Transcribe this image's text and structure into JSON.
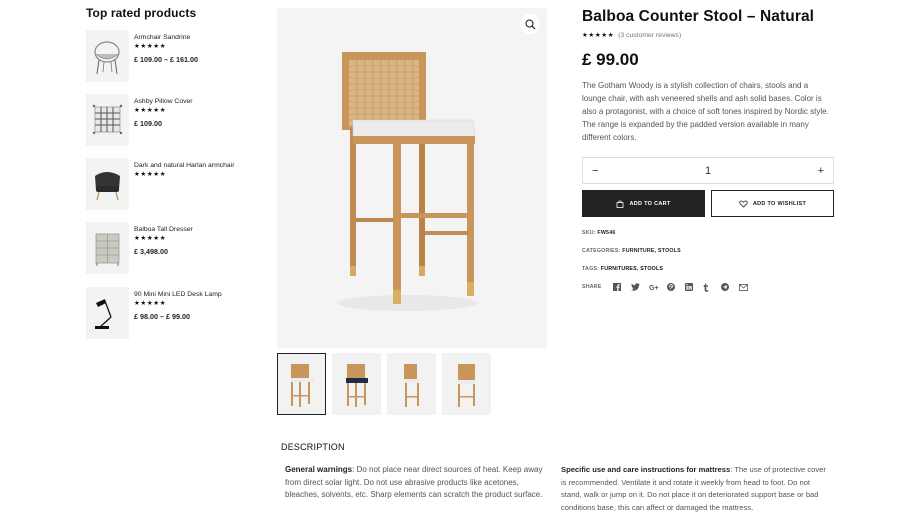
{
  "sidebar": {
    "title": "Top rated products",
    "items": [
      {
        "name": "Armchair Sandrine",
        "stars": "★★★★★",
        "price": "£ 109.00 – £ 161.00",
        "image": "armchair-icon"
      },
      {
        "name": "Ashby Pillow Cover",
        "stars": "★★★★★",
        "price": "£ 109.00",
        "image": "pillow-icon"
      },
      {
        "name": "Dark and natural Harlan armchair",
        "stars": "★★★★★",
        "price": "",
        "image": "armchair-icon"
      },
      {
        "name": "Balboa Tall Dresser",
        "stars": "★★★★★",
        "price": "£ 3,498.00",
        "image": "dresser-icon"
      },
      {
        "name": "90 Mini Mini LED Desk Lamp",
        "stars": "★★★★★",
        "price": "£ 98.00 – £ 99.00",
        "image": "lamp-icon"
      }
    ]
  },
  "product": {
    "title": "Balboa Counter Stool – Natural",
    "stars": "★★★★★",
    "reviews": "(3 customer reviews)",
    "price": "£ 99.00",
    "description": "The Gotham Woody is a stylish collection of chairs, stools and a lounge chair, with ash veneered shells and ash solid bases. Color is also a protagonist, with a choice of soft tones inspired by Nordic style. The range is expanded by the padded version available in many different colors.",
    "quantity": "1",
    "minus": "−",
    "plus": "+",
    "add_to_cart": "ADD TO CART",
    "add_to_wishlist": "ADD TO WISHLIST",
    "sku_label": "SKU:",
    "sku": "FW546",
    "categories_label": "CATEGORIES:",
    "categories": "FURNITURE, STOOLS",
    "tags_label": "TAGS:",
    "tags": "FURNITURES, STOOLS",
    "share_label": "SHARE",
    "share_icons": [
      "facebook-icon",
      "twitter-icon",
      "google-plus-icon",
      "pinterest-icon",
      "linkedin-icon",
      "tumblr-icon",
      "telegram-icon",
      "email-icon"
    ]
  },
  "gallery": {
    "zoom_icon": "search-icon",
    "thumbnails": [
      "natural-stool",
      "navy-stool",
      "natural-stool-side",
      "natural-stool-back"
    ]
  },
  "description_section": {
    "heading": "DESCRIPTION",
    "col1_title": "General warnings",
    "col1_text": ": Do not place near direct sources of heat. Keep away from direct solar light. Do not use abrasive products like acetones, bleaches, solvents, etc. Sharp elements can scratch the product surface.",
    "col2_title": "Specific use and care instructions for mattress",
    "col2_text": ": The use of protective cover is recommended. Ventilate it and rotate it weekly from head to foot. Do not stand, walk or jump on it. Do not place it on deteriorated support base or bad conditions base, this can affect or damaged the mattress."
  },
  "colors": {
    "dark": "#222222",
    "accent_wood": "#c8955a",
    "cushion": "#ececec",
    "navy": "#1f2d44"
  }
}
